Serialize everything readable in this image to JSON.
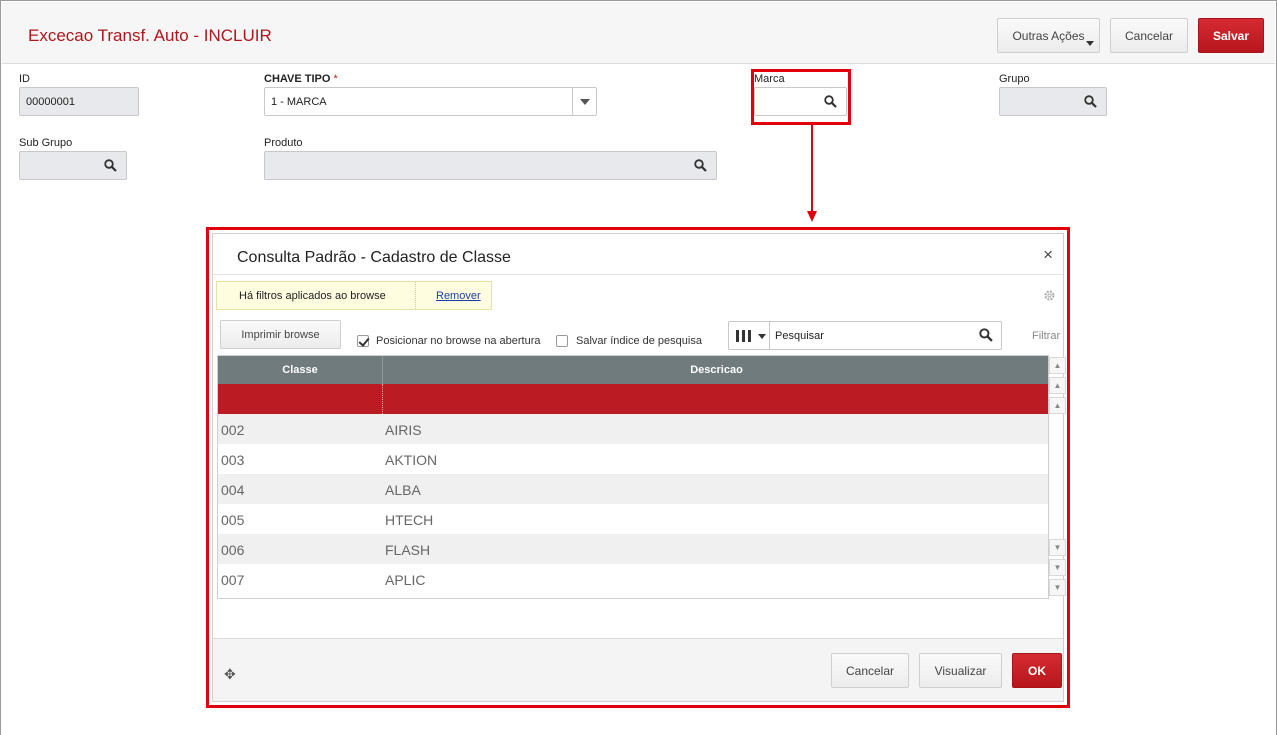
{
  "header": {
    "title": "Excecao Transf. Auto - INCLUIR",
    "buttons": {
      "more_actions": "Outras Ações",
      "cancel": "Cancelar",
      "save": "Salvar"
    }
  },
  "form": {
    "id": {
      "label": "ID",
      "value": "00000001"
    },
    "chave_tipo": {
      "label": "CHAVE TIPO",
      "required_mark": "*",
      "value": "1 - MARCA"
    },
    "marca": {
      "label": "Marca",
      "value": ""
    },
    "grupo": {
      "label": "Grupo",
      "value": ""
    },
    "sub_grupo": {
      "label": "Sub Grupo",
      "value": ""
    },
    "produto": {
      "label": "Produto",
      "value": ""
    }
  },
  "dialog": {
    "title": "Consulta Padrão - Cadastro de Classe",
    "close": "×",
    "filter_notice": "Há filtros aplicados ao browse",
    "filter_remove": "Remover",
    "print_button": "Imprimir browse",
    "position_checkbox": {
      "label": "Posicionar no browse na abertura",
      "checked": true
    },
    "save_index_checkbox": {
      "label": "Salvar índice de pesquisa",
      "checked": false
    },
    "search_placeholder": "Pesquisar",
    "filter_label": "Filtrar",
    "grid": {
      "columns": [
        "Classe",
        "Descricao"
      ],
      "rows": [
        {
          "classe": "",
          "descricao": ""
        },
        {
          "classe": "002",
          "descricao": "AIRIS"
        },
        {
          "classe": "003",
          "descricao": "AKTION"
        },
        {
          "classe": "004",
          "descricao": "ALBA"
        },
        {
          "classe": "005",
          "descricao": "HTECH"
        },
        {
          "classe": "006",
          "descricao": "FLASH"
        },
        {
          "classe": "007",
          "descricao": "APLIC"
        }
      ]
    },
    "footer": {
      "cancel": "Cancelar",
      "view": "Visualizar",
      "ok": "OK"
    }
  },
  "colors": {
    "title_red": "#b0161e",
    "primary_red": "#bb1b22",
    "annotation_red": "#e2000f",
    "grid_header": "#6f7b7d"
  }
}
